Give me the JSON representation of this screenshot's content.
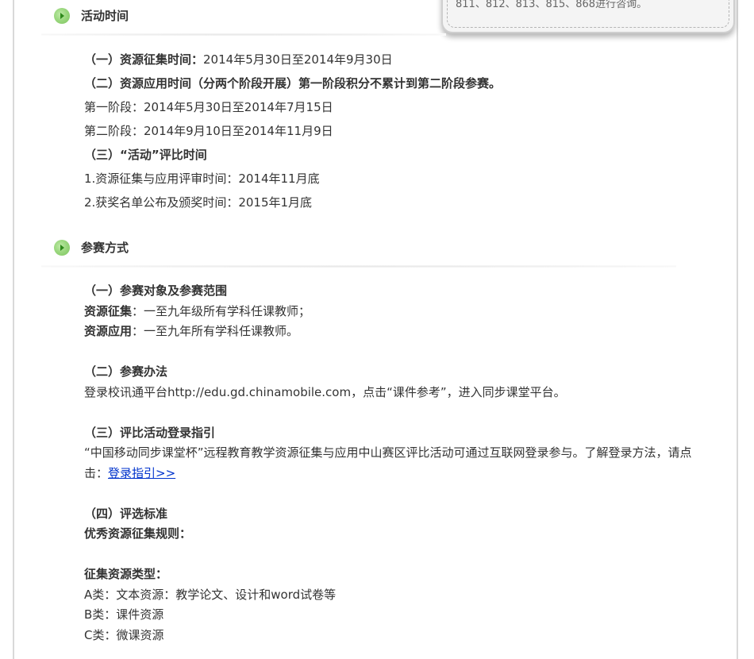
{
  "callout_text": "811、812、813、815、868进行咨询。",
  "sections": [
    {
      "title": "活动时间"
    },
    {
      "title": "参赛方式"
    }
  ],
  "time": {
    "l1": "（一）资源征集时间：",
    "l1_value": "2014年5月30日至2014年9月30日",
    "l2": "（二）资源应用时间（分两个阶段开展）第一阶段积分不累计到第二阶段参赛。",
    "l3": "第一阶段：2014年5月30日至2014年7月15日",
    "l4": "第二阶段：2014年9月10日至2014年11月9日",
    "l5": "（三）“活动”评比时间",
    "l6": "1.资源征集与应用评审时间：2014年11月底",
    "l7": "2.获奖名单公布及颁奖时间：2015年1月底"
  },
  "method": {
    "h1": "（一）参赛对象及参赛范围",
    "collect_label": "资源征集",
    "collect_text": "：一至九年级所有学科任课教师；",
    "apply_label": "资源应用",
    "apply_text": "：一至九年所有学科任课教师。",
    "h2": "（二）参赛办法",
    "method_text": "登录校讯通平台http://edu.gd.chinamobile.com，点击“课件参考”，进入同步课堂平台。",
    "h3": "（三）评比活动登录指引",
    "guide_text_1": "“中国移动同步课堂杯”远程教育教学资源征集与应用中山赛区评比活动可通过互联网登录参与。了解登录方法，请点",
    "guide_text_2": "击：",
    "guide_link": "登录指引>>",
    "h4": "（四）评选标准",
    "rules_title": "优秀资源征集规则：",
    "types_title": "征集资源类型：",
    "type_a": "A类：文本资源：教学论文、设计和word试卷等",
    "type_b": "B类：课件资源",
    "type_c": "C类：微课资源"
  },
  "colors": {
    "bullet": "#8fd36f",
    "link": "#0033cc"
  }
}
